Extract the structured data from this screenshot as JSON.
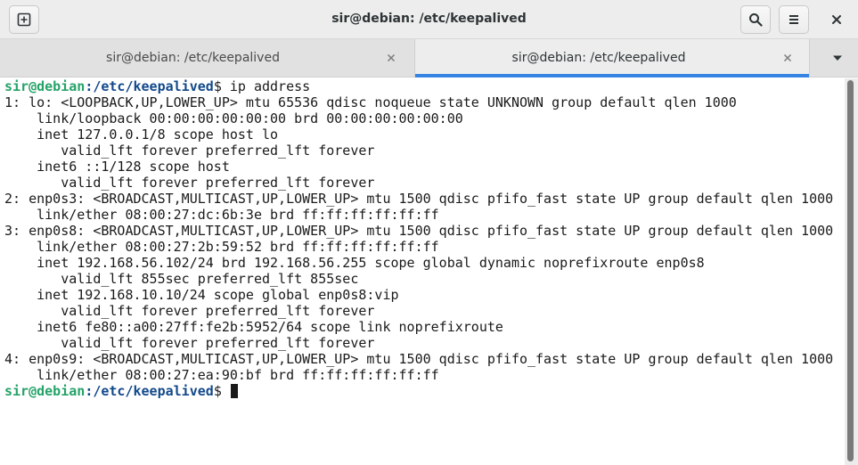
{
  "window": {
    "title": "sir@debian: /etc/keepalived",
    "new_tab_icon": "new-tab-icon",
    "search_icon": "search-icon",
    "menu_icon": "hamburger-menu-icon",
    "close_icon": "close-icon"
  },
  "tabs": [
    {
      "label": "sir@debian: /etc/keepalived",
      "active": false
    },
    {
      "label": "sir@debian: /etc/keepalived",
      "active": true
    }
  ],
  "colors": {
    "prompt_user": "#26a269",
    "prompt_path": "#12488b",
    "active_tab_underline": "#3584e4"
  },
  "terminal": {
    "prompt_user": "sir@debian",
    "prompt_path": ":/etc/keepalived",
    "prompt_symbol": "$ ",
    "command": "ip address",
    "output": [
      "1: lo: <LOOPBACK,UP,LOWER_UP> mtu 65536 qdisc noqueue state UNKNOWN group default qlen 1000",
      "    link/loopback 00:00:00:00:00:00 brd 00:00:00:00:00:00",
      "    inet 127.0.0.1/8 scope host lo",
      "       valid_lft forever preferred_lft forever",
      "    inet6 ::1/128 scope host",
      "       valid_lft forever preferred_lft forever",
      "2: enp0s3: <BROADCAST,MULTICAST,UP,LOWER_UP> mtu 1500 qdisc pfifo_fast state UP group default qlen 1000",
      "    link/ether 08:00:27:dc:6b:3e brd ff:ff:ff:ff:ff:ff",
      "3: enp0s8: <BROADCAST,MULTICAST,UP,LOWER_UP> mtu 1500 qdisc pfifo_fast state UP group default qlen 1000",
      "    link/ether 08:00:27:2b:59:52 brd ff:ff:ff:ff:ff:ff",
      "    inet 192.168.56.102/24 brd 192.168.56.255 scope global dynamic noprefixroute enp0s8",
      "       valid_lft 855sec preferred_lft 855sec",
      "    inet 192.168.10.10/24 scope global enp0s8:vip",
      "       valid_lft forever preferred_lft forever",
      "    inet6 fe80::a00:27ff:fe2b:5952/64 scope link noprefixroute",
      "       valid_lft forever preferred_lft forever",
      "4: enp0s9: <BROADCAST,MULTICAST,UP,LOWER_UP> mtu 1500 qdisc pfifo_fast state UP group default qlen 1000",
      "    link/ether 08:00:27:ea:90:bf brd ff:ff:ff:ff:ff:ff"
    ]
  }
}
